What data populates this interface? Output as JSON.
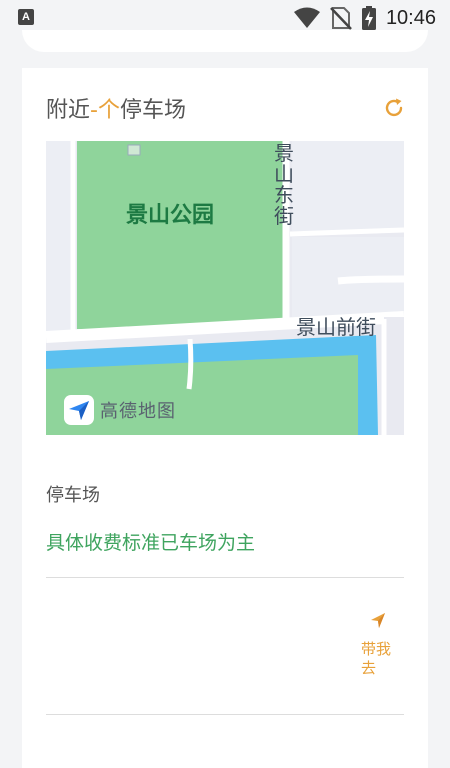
{
  "status_bar": {
    "left_icon": "A",
    "time": "10:46",
    "icons": [
      "wifi-icon",
      "no-sim-icon",
      "battery-charging-icon"
    ]
  },
  "card": {
    "title_prefix": "附近",
    "title_accent": "-个",
    "title_suffix": "停车场",
    "refresh_icon": "refresh-icon",
    "map": {
      "park_name": "景山公园",
      "east_street": "景山东街",
      "front_street": "景山前街",
      "logo_text": "高德地图"
    },
    "parking_label": "停车场",
    "fee_note": "具体收费标准已车场为主",
    "navigate_label": "带我去",
    "navigate_icon": "navigation-arrow-icon"
  },
  "colors": {
    "accent": "#e8a13a",
    "green_text": "#3fa45f",
    "park_green": "#8fd49b",
    "water_blue": "#5bc0f0"
  }
}
